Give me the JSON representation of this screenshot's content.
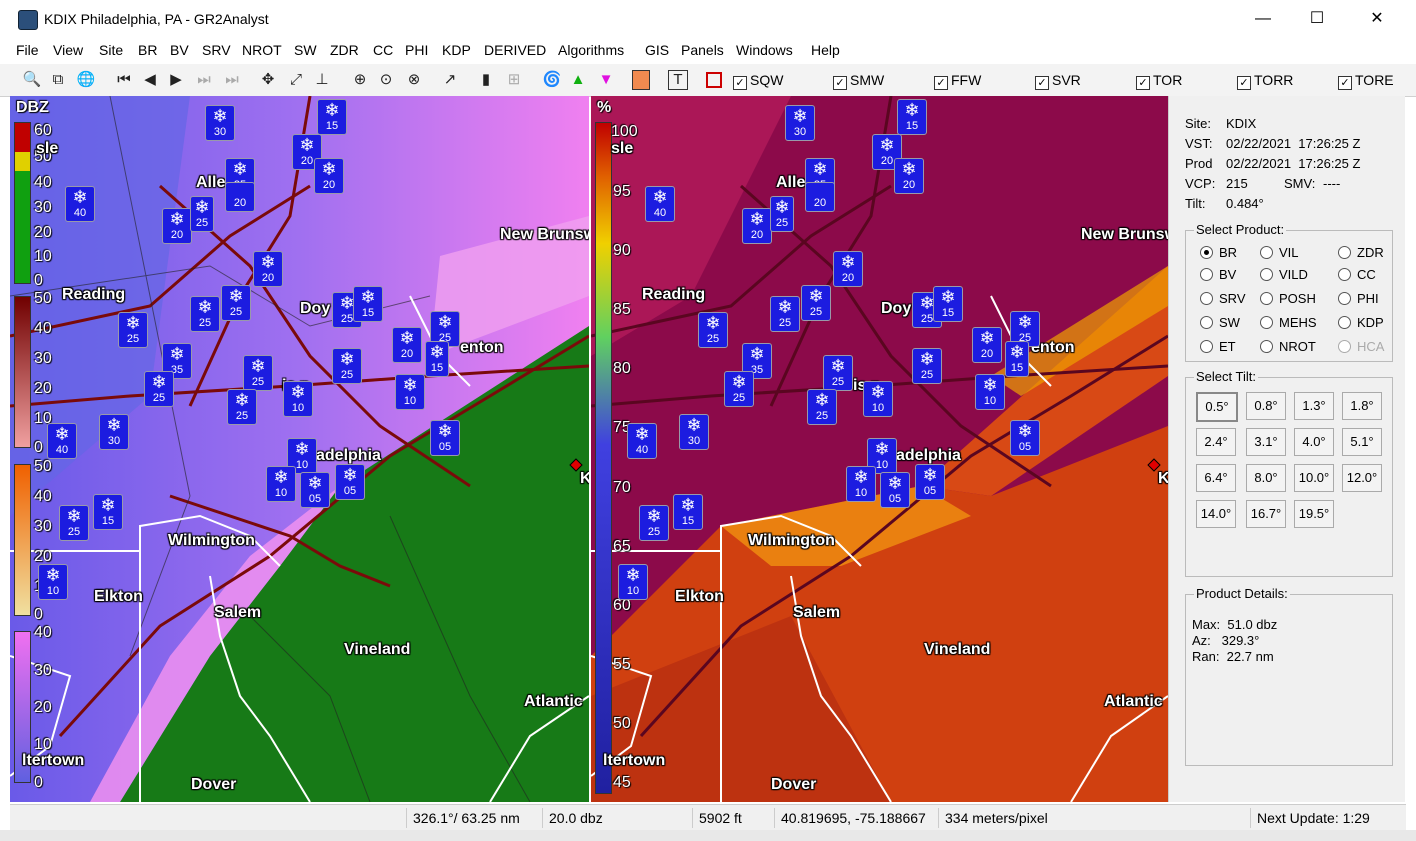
{
  "window": {
    "title": "KDIX Philadelphia, PA - GR2Analyst",
    "minimize": "—",
    "maximize": "☐",
    "close": "✕"
  },
  "menu": [
    "File",
    "View",
    "Site",
    "BR",
    "BV",
    "SRV",
    "NROT",
    "SW",
    "ZDR",
    "CC",
    "PHI",
    "KDP",
    "DERIVED",
    "Algorithms",
    "GIS",
    "Panels",
    "Windows",
    "Help"
  ],
  "toolbar": {
    "warnings": [
      {
        "label": "SQW",
        "checked": true
      },
      {
        "label": "SMW",
        "checked": true
      },
      {
        "label": "FFW",
        "checked": true
      },
      {
        "label": "SVR",
        "checked": true
      },
      {
        "label": "TOR",
        "checked": true
      },
      {
        "label": "TORR",
        "checked": true
      },
      {
        "label": "TORE",
        "checked": true
      }
    ]
  },
  "left_pane": {
    "unit": "DBZ",
    "legend_ticks": [
      "60",
      "50",
      "40",
      "30",
      "20",
      "10",
      "0",
      "50",
      "40",
      "30",
      "20",
      "10",
      "0",
      "50",
      "40",
      "30",
      "20",
      "10",
      "0",
      "40",
      "30",
      "20",
      "10",
      "0"
    ]
  },
  "right_pane": {
    "unit": "%",
    "legend_ticks": [
      "100",
      "95",
      "90",
      "85",
      "80",
      "75",
      "70",
      "65",
      "60",
      "55",
      "50",
      "45"
    ]
  },
  "cities": [
    "Allentown",
    "New Brunswick",
    "Reading",
    "Doylestown",
    "Trenton",
    "Norristown",
    "Philadelphia",
    "Wilmington",
    "Elkton",
    "Salem",
    "Vineland",
    "Atlantic City",
    "Dover",
    "Middletown",
    "Kennedy"
  ],
  "city_labels": {
    "allentown": "Alle    wn",
    "newbrunswick": "New Brunsw",
    "reading": "Reading",
    "doylestown": "Doy",
    "trenton": "enton",
    "norristown": "is    n",
    "philadelphia": "adelphia",
    "wilmington": "Wilmington",
    "elkton": "Elkton",
    "salem": "Salem",
    "vineland": "Vineland",
    "atlantic": "Atlantic",
    "dover": "Dover",
    "middletown": "ltertown",
    "k": "K",
    "sle": "sle"
  },
  "snow_reports": [
    "30",
    "15",
    "20",
    "20",
    "35",
    "20",
    "40",
    "20",
    "25",
    "20",
    "25",
    "25",
    "25",
    "25",
    "25",
    "15",
    "35",
    "25",
    "20",
    "25",
    "25",
    "10",
    "25",
    "15",
    "10",
    "40",
    "30",
    "10",
    "10",
    "05",
    "05",
    "25",
    "15",
    "10",
    "05"
  ],
  "site_info": {
    "site_label": "Site:",
    "site": "KDIX",
    "vst_label": "VST:",
    "vst": "02/22/2021  17:26:25 Z",
    "prod_label": "Prod",
    "prod": "02/22/2021  17:26:25 Z",
    "vcp_label": "VCP:",
    "vcp": "215",
    "smv_label": "SMV:",
    "smv": "----",
    "tilt_label": "Tilt:",
    "tilt": "0.484°"
  },
  "select_product": {
    "label": "Select Product:",
    "options": [
      {
        "label": "BR",
        "selected": true,
        "disabled": false
      },
      {
        "label": "VIL",
        "selected": false,
        "disabled": false
      },
      {
        "label": "ZDR",
        "selected": false,
        "disabled": false
      },
      {
        "label": "BV",
        "selected": false,
        "disabled": false
      },
      {
        "label": "VILD",
        "selected": false,
        "disabled": false
      },
      {
        "label": "CC",
        "selected": false,
        "disabled": false
      },
      {
        "label": "SRV",
        "selected": false,
        "disabled": false
      },
      {
        "label": "POSH",
        "selected": false,
        "disabled": false
      },
      {
        "label": "PHI",
        "selected": false,
        "disabled": false
      },
      {
        "label": "SW",
        "selected": false,
        "disabled": false
      },
      {
        "label": "MEHS",
        "selected": false,
        "disabled": false
      },
      {
        "label": "KDP",
        "selected": false,
        "disabled": false
      },
      {
        "label": "ET",
        "selected": false,
        "disabled": false
      },
      {
        "label": "NROT",
        "selected": false,
        "disabled": false
      },
      {
        "label": "HCA",
        "selected": false,
        "disabled": true
      }
    ]
  },
  "select_tilt": {
    "label": "Select Tilt:",
    "tilts": [
      "0.5°",
      "0.8°",
      "1.3°",
      "1.8°",
      "2.4°",
      "3.1°",
      "4.0°",
      "5.1°",
      "6.4°",
      "8.0°",
      "10.0°",
      "12.0°",
      "14.0°",
      "16.7°",
      "19.5°"
    ],
    "selected": "0.5°"
  },
  "product_details": {
    "label": "Product Details:",
    "max": "Max:  51.0 dbz",
    "az": "Az:   329.3°",
    "ran": "Ran:  22.7 nm"
  },
  "status": {
    "bearing": "326.1°/ 63.25 nm",
    "value": "20.0 dbz",
    "height": "5902 ft",
    "latlon": "40.819695, -75.188667",
    "scale": "334 meters/pixel",
    "next_update": "Next Update: 1:29"
  },
  "colors": {
    "left_rain": "#8a62f0",
    "left_snow": "#1a7a1a",
    "right_bg": "#8c0a4a",
    "snow_badge": "#1c1ce0"
  }
}
